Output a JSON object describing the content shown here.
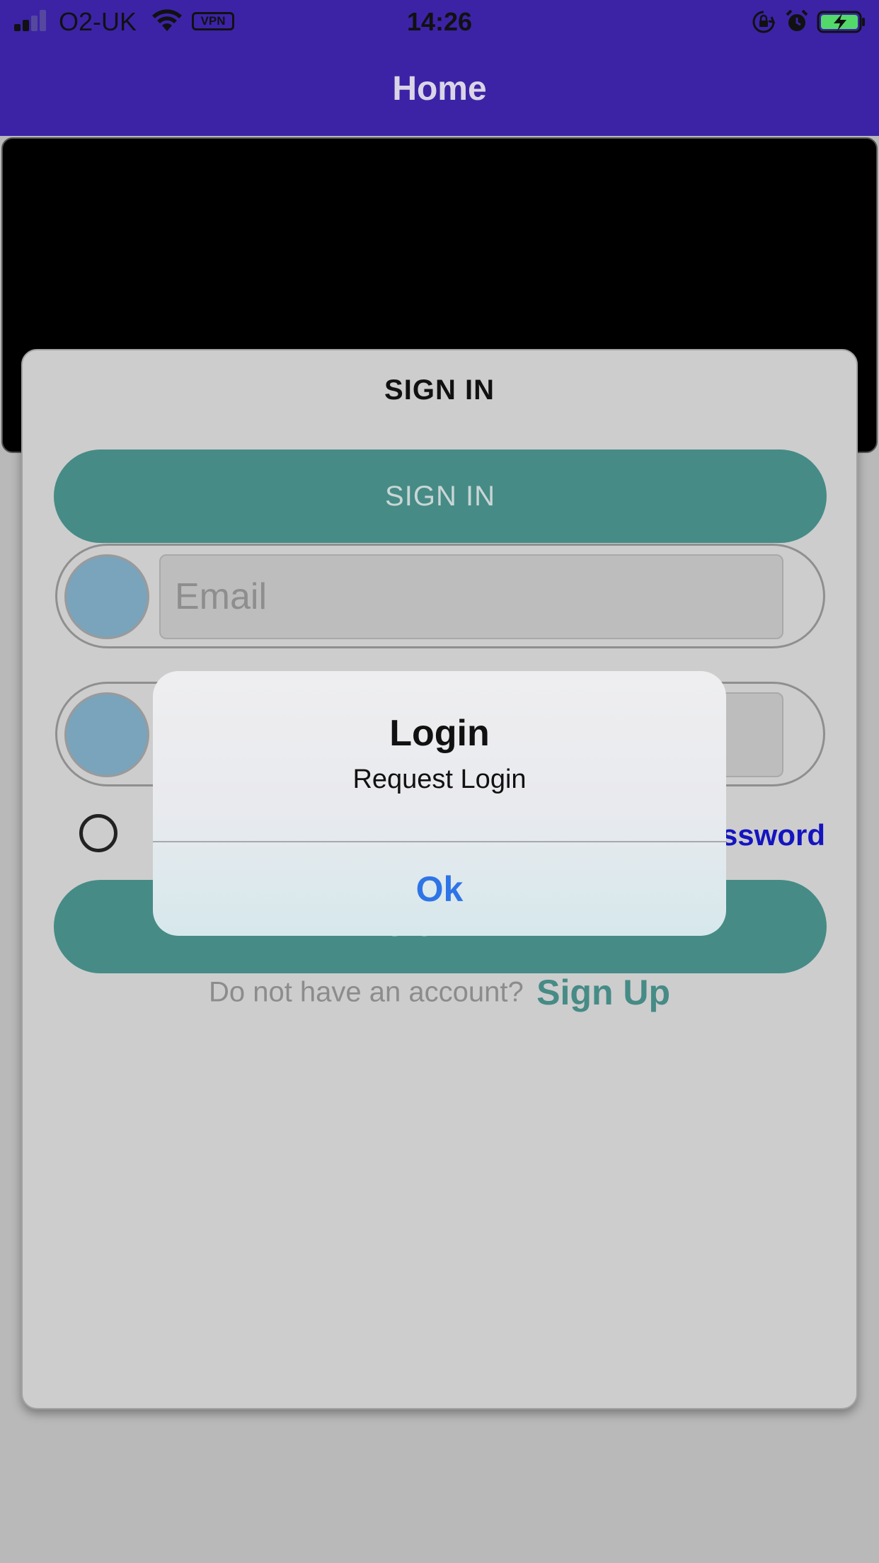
{
  "status_bar": {
    "carrier": "O2-UK",
    "vpn_label": "VPN",
    "time": "14:26",
    "icons": [
      "signal-icon",
      "wifi-icon",
      "orientation-lock-icon",
      "alarm-icon",
      "battery-charging-icon"
    ],
    "battery_color": "#52d96a"
  },
  "nav": {
    "title": "Home",
    "bar_color": "#3c23a6"
  },
  "signin_card": {
    "title": "SIGN IN",
    "top_button_label": "SIGN IN",
    "email_placeholder": "Email",
    "remember_radio_checked": false,
    "forgot_password_visible": "ssword",
    "bottom_button_label": "SIGN IN",
    "signup_prompt": "Do not have an account?",
    "signup_link": "Sign Up",
    "accent_color": "#468b86"
  },
  "alert": {
    "title": "Login",
    "message": "Request Login",
    "ok_label": "Ok",
    "ok_color": "#2f74e6"
  }
}
